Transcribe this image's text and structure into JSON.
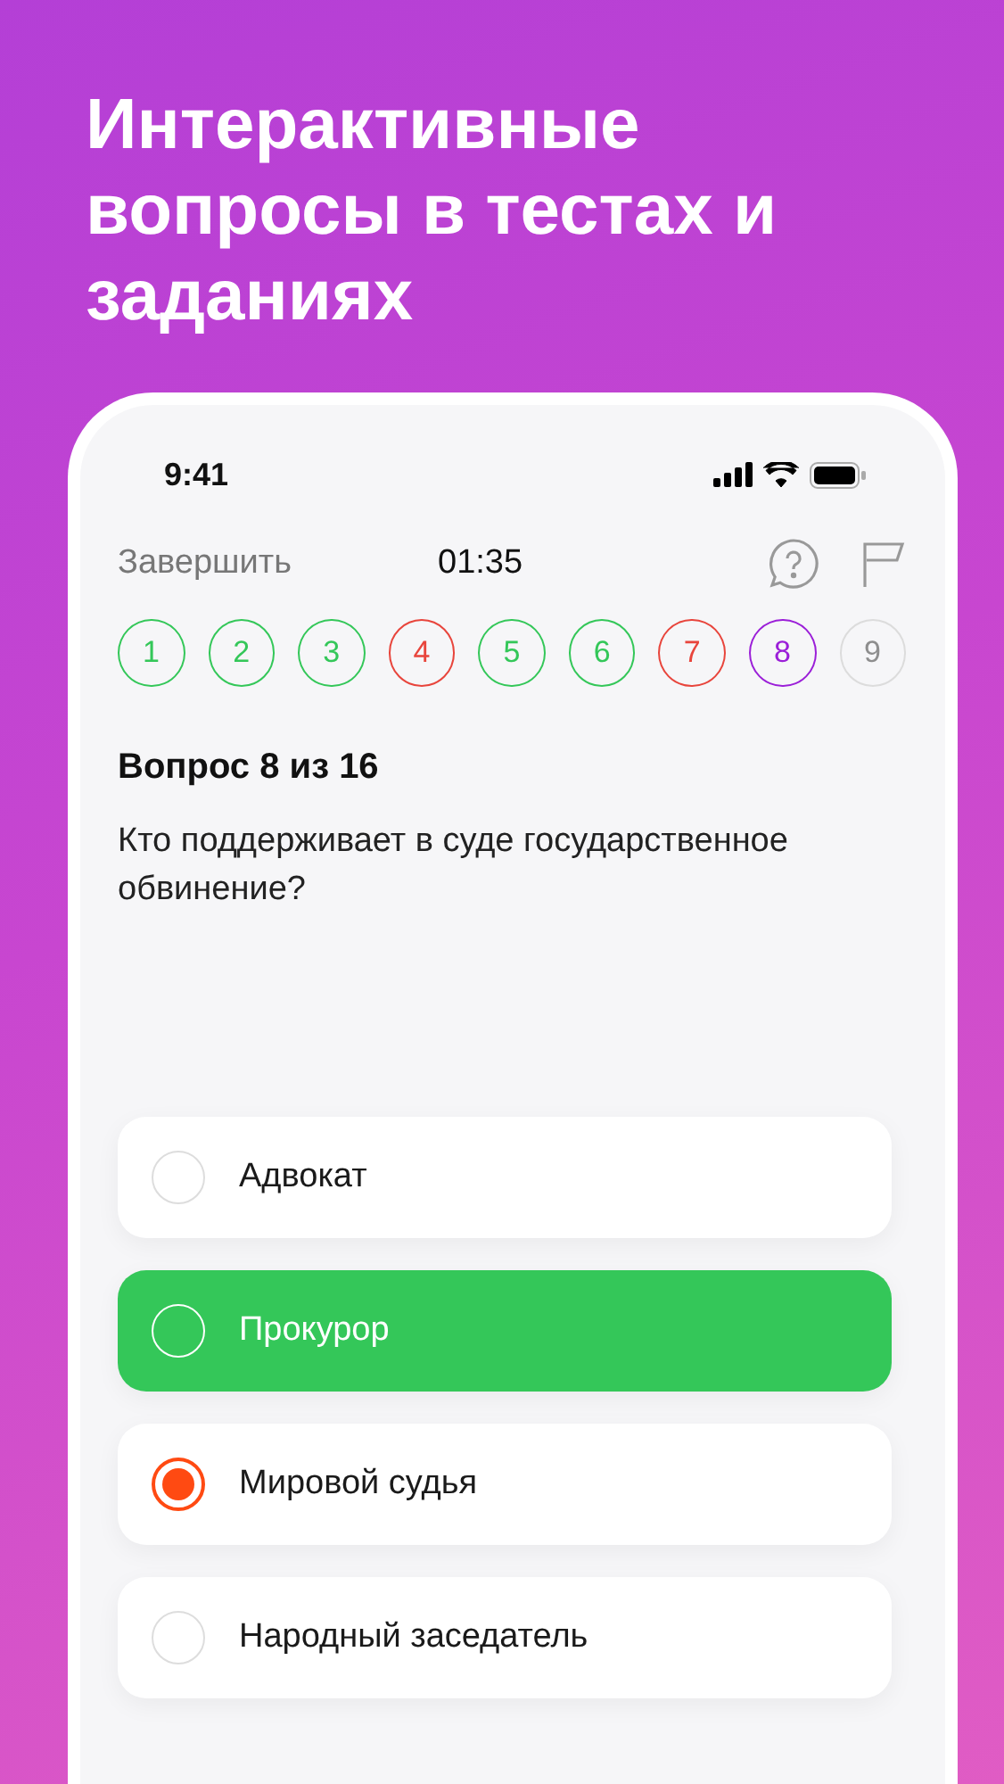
{
  "headline": "Интерактивные вопросы в тестах и заданиях",
  "status_bar": {
    "time": "9:41"
  },
  "toolbar": {
    "finish": "Завершить",
    "timer": "01:35"
  },
  "question_dots": [
    {
      "label": "1",
      "kind": "correct"
    },
    {
      "label": "2",
      "kind": "correct"
    },
    {
      "label": "3",
      "kind": "correct"
    },
    {
      "label": "4",
      "kind": "wrong"
    },
    {
      "label": "5",
      "kind": "correct"
    },
    {
      "label": "6",
      "kind": "correct"
    },
    {
      "label": "7",
      "kind": "wrong"
    },
    {
      "label": "8",
      "kind": "current"
    },
    {
      "label": "9",
      "kind": "pending"
    }
  ],
  "question": {
    "title": "Вопрос 8 из 16",
    "text": "Кто поддерживает в суде государственное обвинение?"
  },
  "answers": [
    {
      "label": "Адвокат",
      "correct": false,
      "selected": false
    },
    {
      "label": "Прокурор",
      "correct": true,
      "selected": false
    },
    {
      "label": "Мировой судья",
      "correct": false,
      "selected": true
    },
    {
      "label": "Народный заседатель",
      "correct": false,
      "selected": false
    }
  ]
}
